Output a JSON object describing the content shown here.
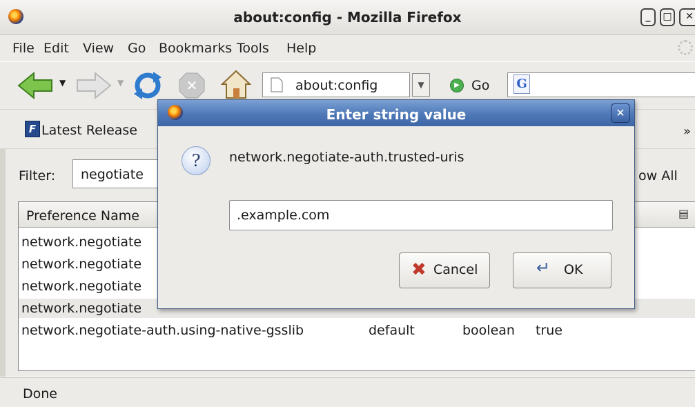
{
  "window": {
    "title": "about:config - Mozilla Firefox"
  },
  "menubar": {
    "items": [
      {
        "label": "File"
      },
      {
        "label": "Edit"
      },
      {
        "label": "View"
      },
      {
        "label": "Go"
      },
      {
        "label": "Bookmarks"
      },
      {
        "label": "Tools"
      },
      {
        "label": "Help"
      }
    ]
  },
  "navbar": {
    "url": "about:config",
    "go_label": "Go",
    "search_engine": "G"
  },
  "bookmarks": {
    "item": "Latest Release",
    "chevron": "»"
  },
  "filter": {
    "label": "Filter:",
    "value": "negotiate",
    "show_all": "ow All"
  },
  "tree": {
    "header_pref": "Preference Name",
    "rows": [
      {
        "name": "network.negotiate",
        "status": "",
        "type": "",
        "value": ""
      },
      {
        "name": "network.negotiate",
        "status": "",
        "type": "",
        "value": ""
      },
      {
        "name": "network.negotiate",
        "status": "",
        "type": "",
        "value": ""
      },
      {
        "name": "network.negotiate",
        "status": "",
        "type": "",
        "value": ""
      },
      {
        "name": "network.negotiate-auth.using-native-gsslib",
        "status": "default",
        "type": "boolean",
        "value": "true"
      }
    ]
  },
  "status": {
    "text": "Done"
  },
  "dialog": {
    "title": "Enter string value",
    "message": "network.negotiate-auth.trusted-uris",
    "input_value": ".example.com",
    "cancel_label": "Cancel",
    "ok_label": "OK",
    "close_glyph": "✕"
  },
  "colors": {
    "dialog_title_bar": "#4f78b7",
    "window_bg": "#edebe7",
    "cancel_icon": "#c0392b"
  },
  "icons": [
    "firefox-logo-icon",
    "back-arrow-icon",
    "forward-arrow-icon",
    "reload-icon",
    "stop-icon",
    "home-icon",
    "page-icon",
    "go-icon",
    "google-icon",
    "question-icon",
    "cancel-x-icon",
    "ok-enter-icon"
  ]
}
